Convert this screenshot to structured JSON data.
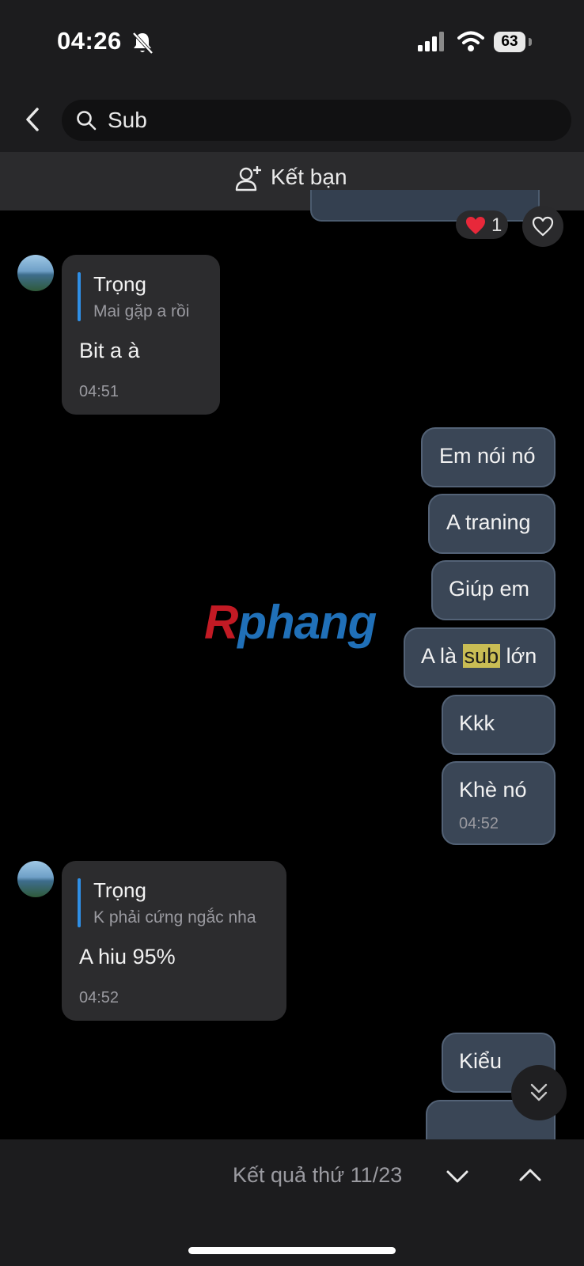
{
  "status_bar": {
    "time": "04:26",
    "battery": "63"
  },
  "header": {
    "search_value": "Sub"
  },
  "friend_bar": {
    "label": "Kết bạn"
  },
  "previous_message": {
    "reaction_emoji": "❤️",
    "reaction_count": "1"
  },
  "messages_incoming_1": {
    "quote_name": "Trọng",
    "quote_text": "Mai gặp a rồi",
    "text": "Bit a à",
    "time": "04:51"
  },
  "messages_outgoing": [
    {
      "text": "Em nói nó"
    },
    {
      "text": "A traning"
    },
    {
      "text": "Giúp em"
    },
    {
      "text_before": "A là ",
      "highlight": "sub",
      "text_after": " lớn"
    },
    {
      "text": "Kkk"
    },
    {
      "text": "Khè nó",
      "time": "04:52"
    }
  ],
  "messages_incoming_2": {
    "quote_name": "Trọng",
    "quote_text": "K phải cứng ngắc nha",
    "text": "A hiu 95%",
    "time": "04:52"
  },
  "messages_outgoing_2": [
    {
      "text": "Kiểu"
    }
  ],
  "watermark": {
    "part1": "R",
    "part2": "phang"
  },
  "bottom_bar": {
    "result_text": "Kết quả thứ 11/23"
  },
  "colors": {
    "accent_quote": "#2f8fe6",
    "outgoing_bg": "#3a4656",
    "highlight": "#c9bd54"
  }
}
